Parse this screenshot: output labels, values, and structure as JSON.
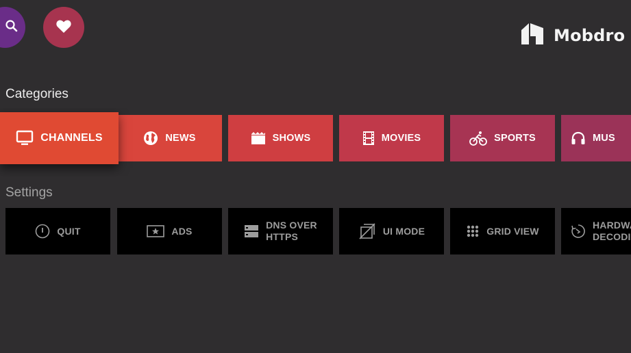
{
  "header": {
    "search_icon": "search-icon",
    "favorites_icon": "heart-icon",
    "logo_icon": "mobdro-logo-icon",
    "logo_text": "Mobdro"
  },
  "categories": {
    "title": "Categories",
    "items": [
      {
        "label": "CHANNELS",
        "icon": "tv-icon",
        "color": "#e04a33",
        "focused": true
      },
      {
        "label": "NEWS",
        "icon": "globe-icon",
        "color": "#d9453c"
      },
      {
        "label": "SHOWS",
        "icon": "clapperboard-icon",
        "color": "#cf3e41"
      },
      {
        "label": "MOVIES",
        "icon": "film-icon",
        "color": "#c0394a"
      },
      {
        "label": "SPORTS",
        "icon": "bicycle-icon",
        "color": "#a73453"
      },
      {
        "label": "MUS",
        "icon": "headphones-icon",
        "color": "#9b3358"
      }
    ]
  },
  "settings": {
    "title": "Settings",
    "items": [
      {
        "label": "QUIT",
        "icon": "power-icon"
      },
      {
        "label": "ADS",
        "icon": "star-box-icon"
      },
      {
        "label_line1": "DNS OVER",
        "label_line2": "HTTPS",
        "icon": "server-icon"
      },
      {
        "label": "UI MODE",
        "icon": "screen-rotation-icon"
      },
      {
        "label": "GRID VIEW",
        "icon": "grid-icon"
      },
      {
        "label_line1": "HARDWA",
        "label_line2": "DECODIN",
        "icon": "decoder-icon"
      }
    ]
  }
}
